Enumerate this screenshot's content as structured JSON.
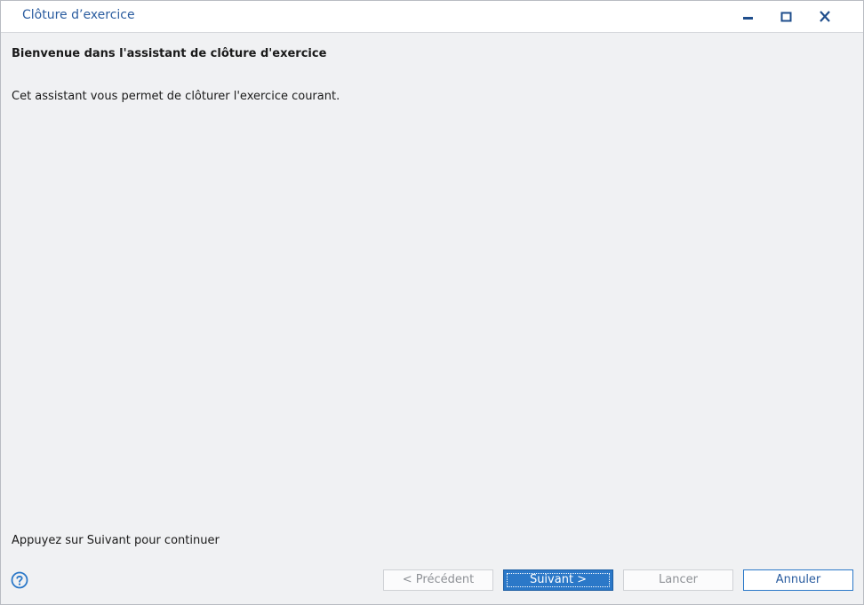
{
  "window": {
    "title": "Clôture d’exercice",
    "controls": {
      "minimize": "minimize-icon",
      "maximize": "maximize-icon",
      "close": "close-icon"
    }
  },
  "main": {
    "heading": "Bienvenue dans l'assistant de clôture d'exercice",
    "description": "Cet assistant vous permet de clôturer l'exercice courant.",
    "hint": "Appuyez sur Suivant pour continuer"
  },
  "footer": {
    "help_icon": "help-icon",
    "previous_label": "< Précédent",
    "next_label": "Suivant >",
    "launch_label": "Lancer",
    "cancel_label": "Annuler"
  },
  "colors": {
    "accent": "#2b78c8",
    "title_text": "#2a5c9f",
    "background": "#f0f1f3"
  }
}
